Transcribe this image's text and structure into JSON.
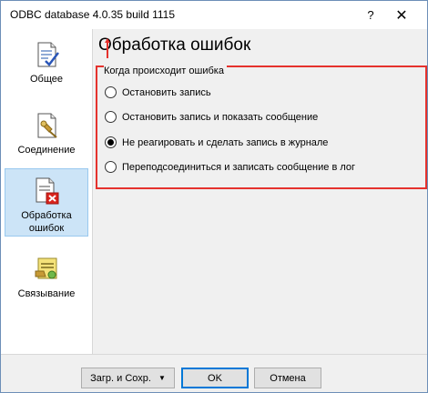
{
  "window": {
    "title": "ODBC database 4.0.35 build 1115",
    "help_glyph": "?",
    "close_glyph": "✕"
  },
  "sidebar": {
    "items": [
      {
        "label": "Общее",
        "icon": "document-check-icon"
      },
      {
        "label": "Соединение",
        "icon": "connection-plug-icon"
      },
      {
        "label": "Обработка ошибок",
        "icon": "document-error-icon",
        "active": true
      },
      {
        "label": "Связывание",
        "icon": "note-link-icon"
      }
    ]
  },
  "main": {
    "heading": "Обработка ошибок",
    "group_label": "Когда происходит ошибка",
    "options": [
      {
        "label": "Остановить запись",
        "checked": false
      },
      {
        "label": "Остановить запись и показать сообщение",
        "checked": false
      },
      {
        "label": "Не реагировать и сделать запись в журнале",
        "checked": true
      },
      {
        "label": "Переподсоединиться и записать сообщение в лог",
        "checked": false
      }
    ]
  },
  "buttons": {
    "load_save": "Загр. и Сохр.",
    "load_save_caret": "▼",
    "ok": "OK",
    "cancel": "Отмена"
  },
  "colors": {
    "highlight_border": "#e5322d",
    "active_nav_bg": "#cce4f7",
    "primary_button_border": "#0078d7"
  }
}
